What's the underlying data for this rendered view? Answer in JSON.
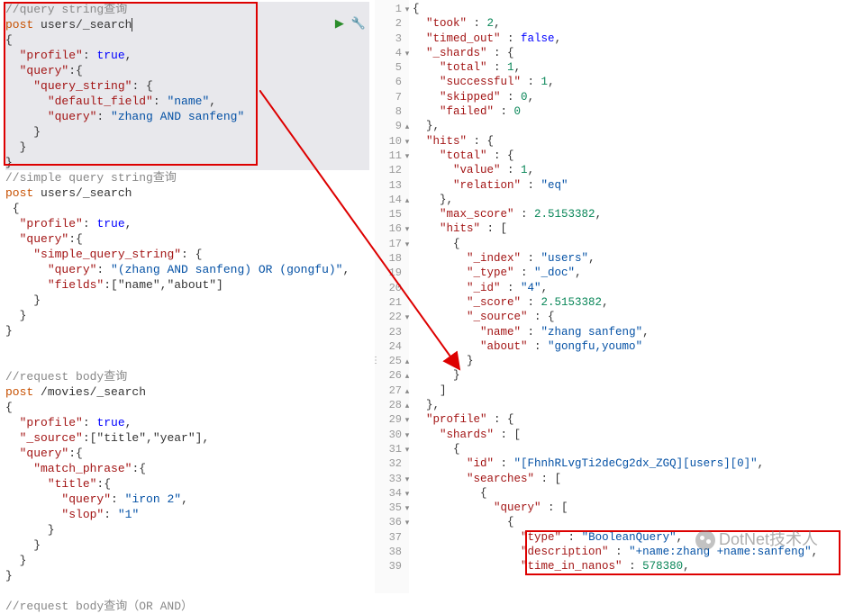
{
  "left": {
    "comment1": "//query string查询",
    "req1_line1": "post users/_search",
    "req1_body": "{\n  \"profile\":true,\n  \"query\":{\n    \"query_string\": {\n      \"default_field\": \"name\",\n      \"query\": \"zhang AND sanfeng\"\n    }\n  }\n}",
    "comment2": "//simple query string查询",
    "req2_line1": "post users/_search",
    "req2_body": " {\n  \"profile\":true,\n  \"query\":{\n    \"simple_query_string\": {\n      \"query\": \"(zhang AND sanfeng) OR (gongfu)\",\n      \"fields\":[\"name\",\"about\"]\n    }\n  }\n}",
    "comment3": "//request body查询",
    "req3_line1": "post /movies/_search",
    "req3_body": "{\n  \"profile\":true,\n  \"_source\":[\"title\",\"year\"],\n  \"query\":{\n    \"match_phrase\":{\n      \"title\":{\n        \"query\":\"iron 2\",\n        \"slop\": \"1\"\n      }\n    }\n  }\n}",
    "comment4": "//request body查询（OR AND）"
  },
  "right": {
    "lines": [
      {
        "n": 1,
        "f": "▾",
        "t": "{"
      },
      {
        "n": 2,
        "t": "  \"took\" : 2,"
      },
      {
        "n": 3,
        "t": "  \"timed_out\" : false,"
      },
      {
        "n": 4,
        "f": "▾",
        "t": "  \"_shards\" : {"
      },
      {
        "n": 5,
        "t": "    \"total\" : 1,"
      },
      {
        "n": 6,
        "t": "    \"successful\" : 1,"
      },
      {
        "n": 7,
        "t": "    \"skipped\" : 0,"
      },
      {
        "n": 8,
        "t": "    \"failed\" : 0"
      },
      {
        "n": 9,
        "f": "▴",
        "t": "  },"
      },
      {
        "n": 10,
        "f": "▾",
        "t": "  \"hits\" : {"
      },
      {
        "n": 11,
        "f": "▾",
        "t": "    \"total\" : {"
      },
      {
        "n": 12,
        "t": "      \"value\" : 1,"
      },
      {
        "n": 13,
        "t": "      \"relation\" : \"eq\""
      },
      {
        "n": 14,
        "f": "▴",
        "t": "    },"
      },
      {
        "n": 15,
        "t": "    \"max_score\" : 2.5153382,"
      },
      {
        "n": 16,
        "f": "▾",
        "t": "    \"hits\" : ["
      },
      {
        "n": 17,
        "f": "▾",
        "t": "      {"
      },
      {
        "n": 18,
        "t": "        \"_index\" : \"users\","
      },
      {
        "n": 19,
        "t": "        \"_type\" : \"_doc\","
      },
      {
        "n": 20,
        "t": "        \"_id\" : \"4\","
      },
      {
        "n": 21,
        "t": "        \"_score\" : 2.5153382,"
      },
      {
        "n": 22,
        "f": "▾",
        "t": "        \"_source\" : {"
      },
      {
        "n": 23,
        "t": "          \"name\" : \"zhang sanfeng\","
      },
      {
        "n": 24,
        "t": "          \"about\" : \"gongfu,youmo\""
      },
      {
        "n": 25,
        "f": "▴",
        "t": "        }"
      },
      {
        "n": 26,
        "f": "▴",
        "t": "      }"
      },
      {
        "n": 27,
        "f": "▴",
        "t": "    ]"
      },
      {
        "n": 28,
        "f": "▴",
        "t": "  },"
      },
      {
        "n": 29,
        "f": "▾",
        "t": "  \"profile\" : {"
      },
      {
        "n": 30,
        "f": "▾",
        "t": "    \"shards\" : ["
      },
      {
        "n": 31,
        "f": "▾",
        "t": "      {"
      },
      {
        "n": 32,
        "t": "        \"id\" : \"[FhnhRLvgTi2deCg2dx_ZGQ][users][0]\","
      },
      {
        "n": 33,
        "f": "▾",
        "t": "        \"searches\" : ["
      },
      {
        "n": 34,
        "f": "▾",
        "t": "          {"
      },
      {
        "n": 35,
        "f": "▾",
        "t": "            \"query\" : ["
      },
      {
        "n": 36,
        "f": "▾",
        "t": "              {"
      },
      {
        "n": 37,
        "t": "                \"type\" : \"BooleanQuery\","
      },
      {
        "n": 38,
        "t": "                \"description\" : \"+name:zhang +name:sanfeng\","
      },
      {
        "n": 39,
        "t": "                \"time_in_nanos\" : 578380,"
      }
    ]
  },
  "watermark": "DotNet技术人"
}
